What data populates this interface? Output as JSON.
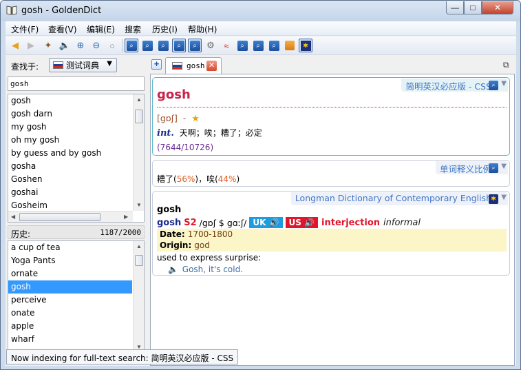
{
  "window": {
    "title": "gosh - GoldenDict",
    "icon": "book-icon",
    "controls": [
      "minimize-icon",
      "maximize-icon",
      "close-icon"
    ]
  },
  "menubar": {
    "items": [
      "文件(F)",
      "查看(V)",
      "编辑(E)",
      "搜索",
      "历史(I)",
      "帮助(H)"
    ]
  },
  "toolbar": {
    "icons": [
      "back-icon",
      "forward-icon",
      "wand-icon",
      "speaker-icon",
      "zoom-in-icon",
      "zoom-out-icon",
      "zoom-reset-icon",
      "dict-icon",
      "dict-icon",
      "dict-icon",
      "dict-icon",
      "dict-icon",
      "gear-icon",
      "wave-icon",
      "dict-icon",
      "dict-icon",
      "dict-icon",
      "orange-dict-icon",
      "longman-dict-icon"
    ],
    "active_index": 7
  },
  "left": {
    "lookin_label": "查找于:",
    "group": "测试词典",
    "search_value": "gosh",
    "words": [
      "gosh",
      "gosh darn",
      "my gosh",
      "oh my gosh",
      "by guess and by gosh",
      "gosha",
      "Goshen",
      "goshai",
      "Gosheim"
    ],
    "history_label": "历史:",
    "history_count": "1187/2000",
    "history": [
      "a cup of tea",
      "Yoga Pants",
      "ornate",
      "gosh",
      "perceive",
      "onate",
      "apple",
      "wharf"
    ],
    "history_selected": 3
  },
  "tabs": [
    {
      "label": "gosh"
    }
  ],
  "article": {
    "dict1": {
      "title": "简明英汉必应版 - CSS",
      "headword": "gosh",
      "phonetic": "[gɒʃ]",
      "dash": "-",
      "star": "★",
      "pos": "int.",
      "meaning": "天啊；唉；糟了；必定",
      "rank": "(7644/10726)"
    },
    "dict2": {
      "title": "单词释义比例",
      "m1": "糟了",
      "p1": "56%",
      "sep": "，",
      "m2": "唉",
      "p2": "44%"
    },
    "dict3": {
      "title": "Longman Dictionary of Contemporary English",
      "headword": "gosh",
      "hw": "gosh",
      "s2": "S2",
      "phon": "/gɒʃ $ gɑːʃ/",
      "uk": "UK",
      "us": "US",
      "pos": "interjection",
      "register": "informal",
      "date_key": "Date:",
      "date_val": "1700-1800",
      "origin_key": "Origin:",
      "origin_val": "god",
      "definition": "used to express surprise:",
      "example": "Gosh, it's cold."
    }
  },
  "status": "Now indexing for full-text search: 简明英汉必应版 - CSS"
}
